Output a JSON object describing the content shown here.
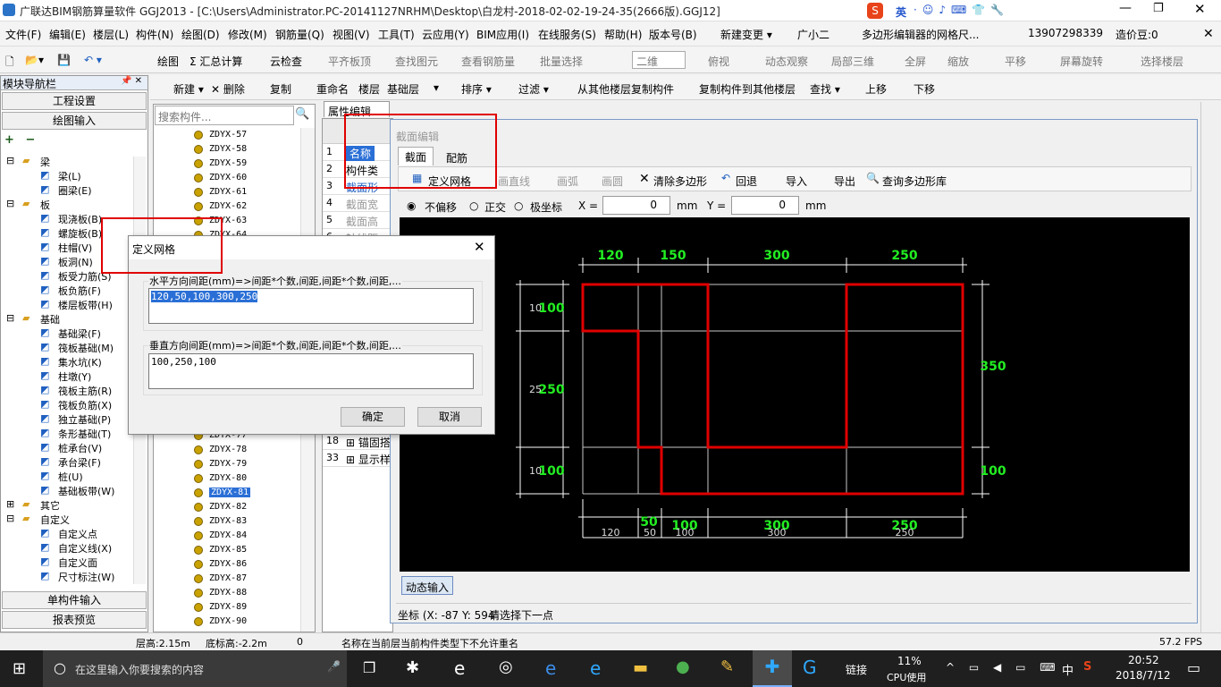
{
  "window": {
    "title": "广联达BIM钢筋算量软件 GGJ2013 - [C:\\Users\\Administrator.PC-20141127NRHM\\Desktop\\白龙村-2018-02-02-19-24-35(2666版).GGJ12]",
    "ime_label": "英",
    "min_icon": "minimize-icon",
    "max_icon": "maximize-icon",
    "close_icon": "close-icon"
  },
  "menu": {
    "items": [
      "文件(F)",
      "编辑(E)",
      "楼层(L)",
      "构件(N)",
      "绘图(D)",
      "修改(M)",
      "钢筋量(Q)",
      "视图(V)",
      "工具(T)",
      "云应用(Y)",
      "BIM应用(I)",
      "在线服务(S)",
      "帮助(H)",
      "版本号(B)",
      "新建变更 ▾",
      "广小二"
    ],
    "hint": "多边形编辑器的网格尺...",
    "phone": "13907298339",
    "price": "造价豆:0"
  },
  "toolbar1": {
    "items": [
      "绘图",
      "Σ 汇总计算",
      "云检查",
      "平齐板顶",
      "查找图元",
      "查看钢筋量",
      "批量选择",
      "二维",
      "俯视",
      "动态观察",
      "局部三维",
      "全屏",
      "缩放",
      "平移",
      "屏幕旋转",
      "选择楼层"
    ]
  },
  "nav": {
    "title": "模块导航栏",
    "pin": "📌 ✕",
    "btn_project": "工程设置",
    "btn_draw": "绘图输入",
    "btn_single": "单构件输入",
    "btn_report": "报表预览",
    "tree": [
      {
        "label": "梁",
        "indent": 0,
        "exp": "⊟"
      },
      {
        "label": "梁(L)",
        "indent": 1
      },
      {
        "label": "圈梁(E)",
        "indent": 1
      },
      {
        "label": "板",
        "indent": 0,
        "exp": "⊟"
      },
      {
        "label": "现浇板(B)",
        "indent": 1
      },
      {
        "label": "螺旋板(B)",
        "indent": 1
      },
      {
        "label": "柱帽(V)",
        "indent": 1
      },
      {
        "label": "板洞(N)",
        "indent": 1
      },
      {
        "label": "板受力筋(S)",
        "indent": 1
      },
      {
        "label": "板负筋(F)",
        "indent": 1
      },
      {
        "label": "楼层板带(H)",
        "indent": 1
      },
      {
        "label": "基础",
        "indent": 0,
        "exp": "⊟"
      },
      {
        "label": "基础梁(F)",
        "indent": 1
      },
      {
        "label": "筏板基础(M)",
        "indent": 1
      },
      {
        "label": "集水坑(K)",
        "indent": 1
      },
      {
        "label": "柱墩(Y)",
        "indent": 1
      },
      {
        "label": "筏板主筋(R)",
        "indent": 1
      },
      {
        "label": "筏板负筋(X)",
        "indent": 1
      },
      {
        "label": "独立基础(P)",
        "indent": 1
      },
      {
        "label": "条形基础(T)",
        "indent": 1
      },
      {
        "label": "桩承台(V)",
        "indent": 1
      },
      {
        "label": "承台梁(F)",
        "indent": 1
      },
      {
        "label": "桩(U)",
        "indent": 1
      },
      {
        "label": "基础板带(W)",
        "indent": 1
      },
      {
        "label": "其它",
        "indent": 0,
        "exp": "⊞"
      },
      {
        "label": "自定义",
        "indent": 0,
        "exp": "⊟"
      },
      {
        "label": "自定义点",
        "indent": 1
      },
      {
        "label": "自定义线(X)",
        "indent": 1
      },
      {
        "label": "自定义面",
        "indent": 1
      },
      {
        "label": "尺寸标注(W)",
        "indent": 1
      }
    ]
  },
  "comp_toolbar": {
    "items": [
      "新建 ▾",
      "✕ 删除",
      "复制",
      "重命名",
      "楼层",
      "基础层",
      "▾",
      "排序 ▾",
      "过滤 ▾",
      "从其他楼层复制构件",
      "复制构件到其他楼层",
      "查找 ▾",
      "上移",
      "下移"
    ]
  },
  "comp_list": {
    "search_placeholder": "搜索构件...",
    "items_top": [
      "ZDYX-57",
      "ZDYX-58",
      "ZDYX-59",
      "ZDYX-60",
      "ZDYX-61",
      "ZDYX-62",
      "ZDYX-63",
      "ZDYX-64"
    ],
    "items_bottom": [
      "ZDYX-77",
      "ZDYX-78",
      "ZDYX-79",
      "ZDYX-80",
      "ZDYX-81",
      "ZDYX-82",
      "ZDYX-83",
      "ZDYX-84",
      "ZDYX-85",
      "ZDYX-86",
      "ZDYX-87",
      "ZDYX-88",
      "ZDYX-89",
      "ZDYX-90"
    ],
    "selected": "ZDYX-81"
  },
  "props": {
    "title": "属性编辑",
    "rows": [
      [
        "1",
        "名称"
      ],
      [
        "2",
        "构件类"
      ],
      [
        "3",
        "截面形"
      ],
      [
        "4",
        "截面宽"
      ],
      [
        "5",
        "截面高"
      ],
      [
        "6",
        "轴线距"
      ]
    ],
    "rows_bottom": [
      [
        "18",
        "⊞ 锚固搭"
      ],
      [
        "33",
        "⊞ 显示样"
      ]
    ]
  },
  "editor": {
    "title": "截面编辑",
    "tabs": [
      "截面",
      "配筋"
    ],
    "tools": [
      "定义网格",
      "画直线",
      "画弧",
      "画圆",
      "清除多边形",
      "回退",
      "导入",
      "导出",
      "查询多边形库"
    ],
    "modes": [
      "不偏移",
      "正交",
      "极坐标"
    ],
    "x_label": "X =",
    "x_value": "0",
    "y_label": "Y =",
    "y_value": "0",
    "unit": "mm",
    "dynamic_input": "动态输入",
    "coord": "坐标 (X: -87 Y: 594",
    "prompt": "请选择下一点"
  },
  "drawing": {
    "top_dims": [
      "120",
      "150",
      "300",
      "250"
    ],
    "left_dims": [
      "100",
      "250",
      "100"
    ],
    "left_dims_small": [
      "10",
      "25",
      "10"
    ],
    "right_dims": [
      "350",
      "100"
    ],
    "bottom_dims_big": [
      "50",
      "100",
      "300",
      "250"
    ],
    "bottom_dims_small": [
      "120",
      "50",
      "100",
      "300",
      "250"
    ]
  },
  "dialog": {
    "title": "定义网格",
    "h_label": "水平方向间距(mm)=>间距*个数,间距,间距*个数,间距,...",
    "h_value": "120,50,100,300,250",
    "v_label": "垂直方向间距(mm)=>间距*个数,间距,间距*个数,间距,...",
    "v_value": "100,250,100",
    "ok": "确定",
    "cancel": "取消"
  },
  "status": {
    "floor_height": "层高:2.15m",
    "base_height": "底标高:-2.2m",
    "zero": "0",
    "message": "名称在当前层当前构件类型下不允许重名",
    "fps": "57.2 FPS"
  },
  "taskbar": {
    "search_placeholder": "在这里输入你要搜索的内容",
    "link": "链接",
    "cpu": "11%",
    "cpu_label": "CPU使用",
    "lang": "中",
    "time": "20:52",
    "date": "2018/7/12"
  }
}
